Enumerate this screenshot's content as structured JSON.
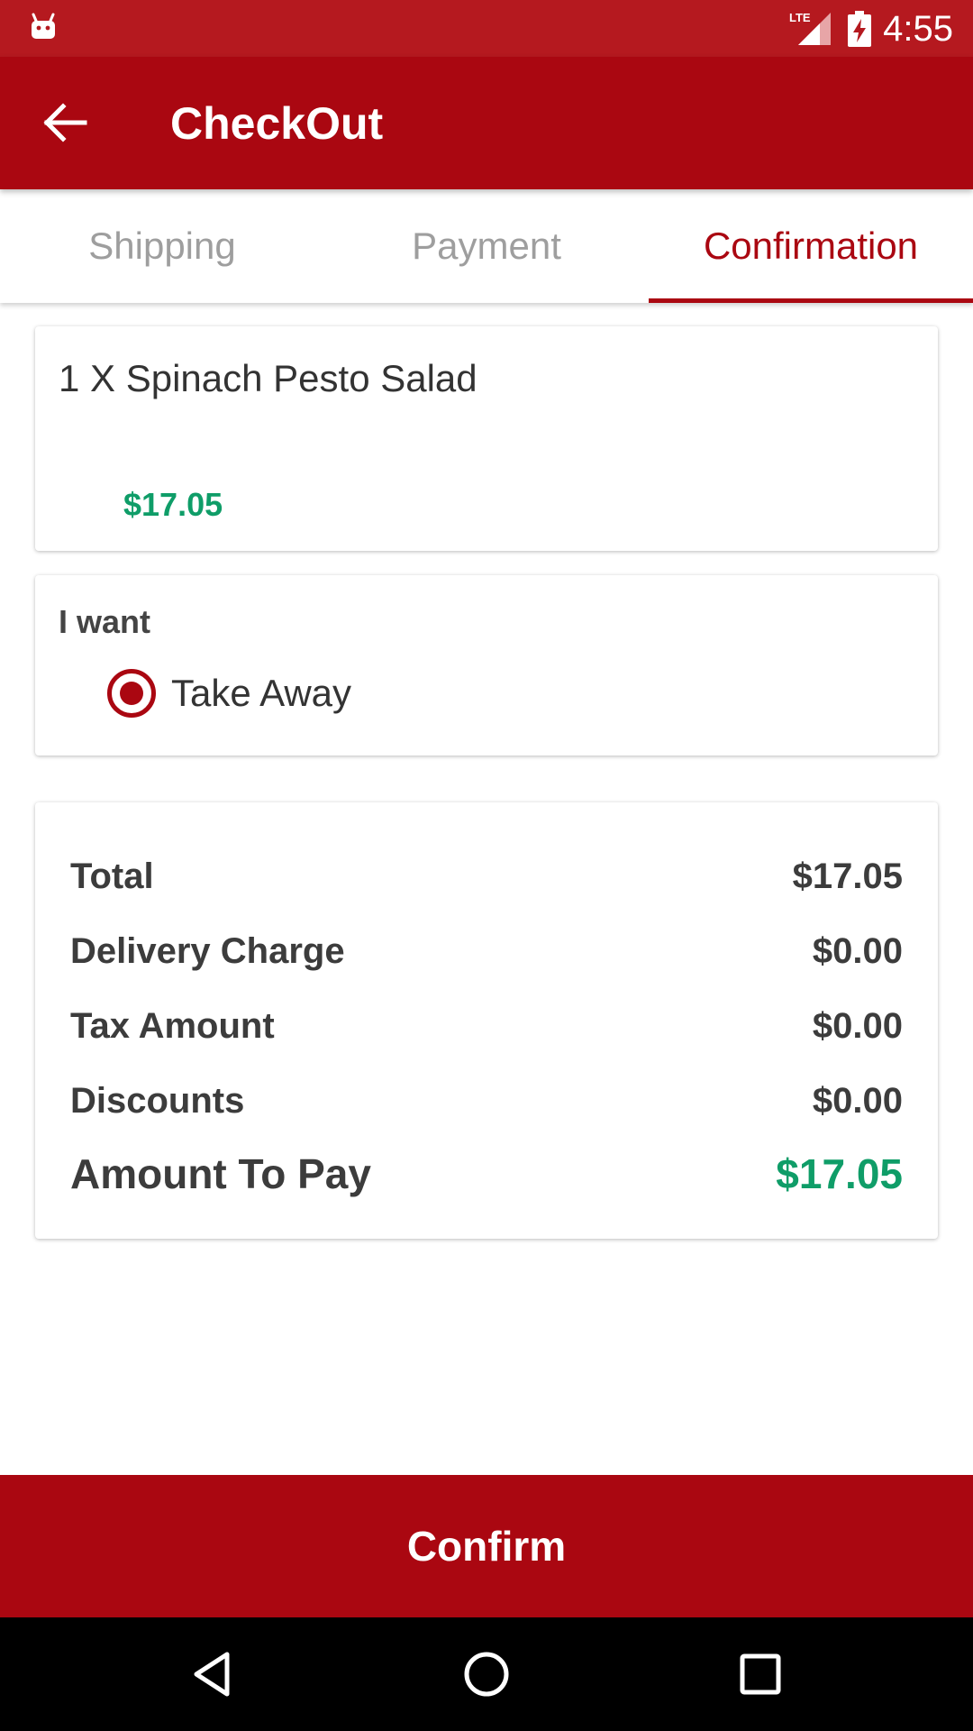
{
  "status_bar": {
    "network_label": "LTE",
    "time": "4:55",
    "icons": [
      "android-robot-icon",
      "lte-signal-icon",
      "battery-charging-icon"
    ]
  },
  "app_bar": {
    "title": "CheckOut",
    "back_icon": "arrow-back-icon"
  },
  "tabs": [
    {
      "label": "Shipping",
      "active": false
    },
    {
      "label": "Payment",
      "active": false
    },
    {
      "label": "Confirmation",
      "active": true
    }
  ],
  "order_item": {
    "name": "1 X Spinach Pesto Salad",
    "price": "$17.05"
  },
  "order_type": {
    "label": "I want",
    "selected_option": "Take Away"
  },
  "summary": {
    "rows": [
      {
        "label": "Total",
        "value": "$17.05"
      },
      {
        "label": "Delivery Charge",
        "value": "$0.00"
      },
      {
        "label": "Tax Amount",
        "value": "$0.00"
      },
      {
        "label": "Discounts",
        "value": "$0.00"
      }
    ],
    "amount_to_pay": {
      "label": "Amount To Pay",
      "value": "$17.05"
    }
  },
  "confirm_button": {
    "label": "Confirm"
  },
  "colors": {
    "status_bar": "#b5191f",
    "primary": "#aa0711",
    "price_green": "#0f9d68",
    "inactive_tab": "#9e9e9e",
    "nav_bar": "#000000"
  }
}
